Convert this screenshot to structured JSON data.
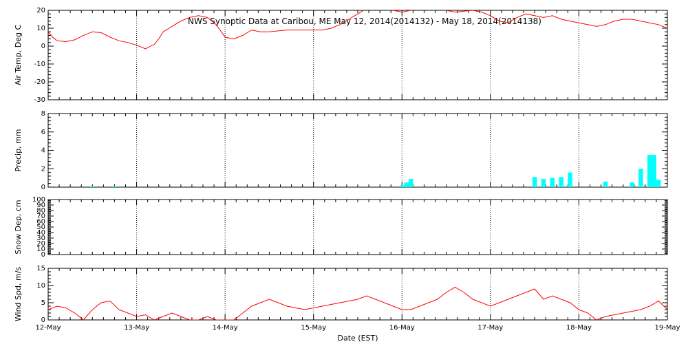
{
  "chart_data": {
    "type": "line",
    "title": "NWS Synoptic Data at Caribou, ME   May 12, 2014(2014132) - May 18, 2014(2014138)",
    "xlabel": "Date (EST)",
    "x_range": [
      "12-May",
      "19-May"
    ],
    "x_tick_labels": [
      "12-May",
      "13-May",
      "14-May",
      "15-May",
      "16-May",
      "17-May",
      "18-May",
      "19-May"
    ],
    "colors": {
      "line": "#ff0000",
      "bars": "#00ffff",
      "axes": "#000000"
    },
    "panels": [
      {
        "name": "air-temp",
        "type": "line",
        "ylabel": "Air Temp, Deg C",
        "ylim": [
          -30,
          20
        ],
        "yticks": [
          -30,
          -20,
          -10,
          0,
          10,
          20
        ],
        "series": [
          {
            "x": [
              0,
              0.05,
              0.1,
              0.2,
              0.3,
              0.4,
              0.5,
              0.6,
              0.7,
              0.8,
              0.9,
              1.0,
              1.1,
              1.2,
              1.25,
              1.3,
              1.4,
              1.5,
              1.6,
              1.7,
              1.8,
              1.9,
              2.0,
              2.1,
              2.2,
              2.3,
              2.4,
              2.5,
              2.6,
              2.7,
              2.8,
              2.9,
              3.0,
              3.1,
              3.2,
              3.3,
              3.4,
              3.5,
              3.6,
              3.7,
              3.8,
              3.9,
              4.0,
              4.1,
              4.2,
              4.3,
              4.4,
              4.5,
              4.6,
              4.7,
              4.8,
              4.9,
              5.0,
              5.1,
              5.2,
              5.3,
              5.4,
              5.5,
              5.6,
              5.7,
              5.8,
              5.9,
              6.0,
              6.1,
              6.2,
              6.3,
              6.4,
              6.5,
              6.6,
              6.7,
              6.8,
              6.9,
              7.0
            ],
            "values": [
              8,
              5,
              3,
              2.5,
              3.5,
              6,
              8,
              7.5,
              5,
              3,
              2,
              0.5,
              -1.5,
              1,
              4,
              8,
              11,
              14,
              16,
              17,
              16,
              12,
              5,
              4,
              6,
              9,
              8,
              8,
              8.5,
              9,
              9,
              9,
              9,
              9,
              10,
              12,
              15,
              18,
              21,
              23,
              22,
              20,
              19,
              20,
              21,
              22,
              21,
              20,
              19,
              19.5,
              20,
              19,
              17,
              14,
              13,
              16,
              18,
              17,
              16,
              17,
              15,
              14,
              13,
              12,
              11,
              12,
              14,
              15,
              15,
              14,
              13,
              12,
              10
            ]
          }
        ]
      },
      {
        "name": "precip",
        "type": "bar",
        "ylabel": "Precip, mm",
        "ylim": [
          0,
          8
        ],
        "yticks": [
          0,
          2,
          4,
          6,
          8
        ],
        "series": [
          {
            "x": [
              0.5,
              0.75,
              4.0,
              4.05,
              4.1,
              5.5,
              5.6,
              5.7,
              5.8,
              5.9,
              6.3,
              6.6,
              6.7,
              6.8,
              6.85,
              6.9
            ],
            "values": [
              0.1,
              0.1,
              0.2,
              0.5,
              0.9,
              1.1,
              0.9,
              1.0,
              1.1,
              1.6,
              0.6,
              0.5,
              2.0,
              3.5,
              3.5,
              0.8
            ]
          }
        ]
      },
      {
        "name": "snow-depth",
        "type": "line",
        "ylabel": "Snow Dep, cm",
        "ylim": [
          0,
          100
        ],
        "yticks": [
          0,
          10,
          20,
          30,
          40,
          50,
          60,
          70,
          80,
          90,
          100
        ],
        "series": []
      },
      {
        "name": "wind-speed",
        "type": "line",
        "ylabel": "Wind Spd, m/s",
        "ylim": [
          0,
          15
        ],
        "yticks": [
          0,
          5,
          10,
          15
        ],
        "series": [
          {
            "x": [
              0,
              0.1,
              0.2,
              0.3,
              0.4,
              0.5,
              0.6,
              0.7,
              0.8,
              0.9,
              1.0,
              1.1,
              1.2,
              1.3,
              1.4,
              1.5,
              1.6,
              1.7,
              1.8,
              1.9,
              2.0,
              2.1,
              2.2,
              2.3,
              2.4,
              2.5,
              2.6,
              2.7,
              2.8,
              2.9,
              3.0,
              3.1,
              3.2,
              3.3,
              3.4,
              3.5,
              3.6,
              3.7,
              3.8,
              3.9,
              4.0,
              4.1,
              4.2,
              4.3,
              4.4,
              4.5,
              4.6,
              4.7,
              4.8,
              4.9,
              5.0,
              5.1,
              5.2,
              5.3,
              5.4,
              5.5,
              5.6,
              5.7,
              5.8,
              5.9,
              6.0,
              6.1,
              6.2,
              6.3,
              6.4,
              6.5,
              6.6,
              6.7,
              6.8,
              6.9,
              7.0
            ],
            "values": [
              3,
              4,
              3.5,
              2,
              0,
              3,
              5,
              5.5,
              3,
              2,
              1,
              1.5,
              0,
              1,
              2,
              1,
              0,
              0,
              1,
              0,
              0,
              0,
              2,
              4,
              5,
              6,
              5,
              4,
              3.5,
              3,
              3.5,
              4,
              4.5,
              5,
              5.5,
              6,
              7,
              6,
              5,
              4,
              3,
              3,
              4,
              5,
              6,
              8,
              9.5,
              8,
              6,
              5,
              4,
              5,
              6,
              7,
              8,
              9,
              6,
              7,
              6,
              5,
              3,
              2,
              0,
              1,
              1.5,
              2,
              2.5,
              3,
              4,
              5.5,
              3
            ]
          }
        ]
      }
    ]
  }
}
